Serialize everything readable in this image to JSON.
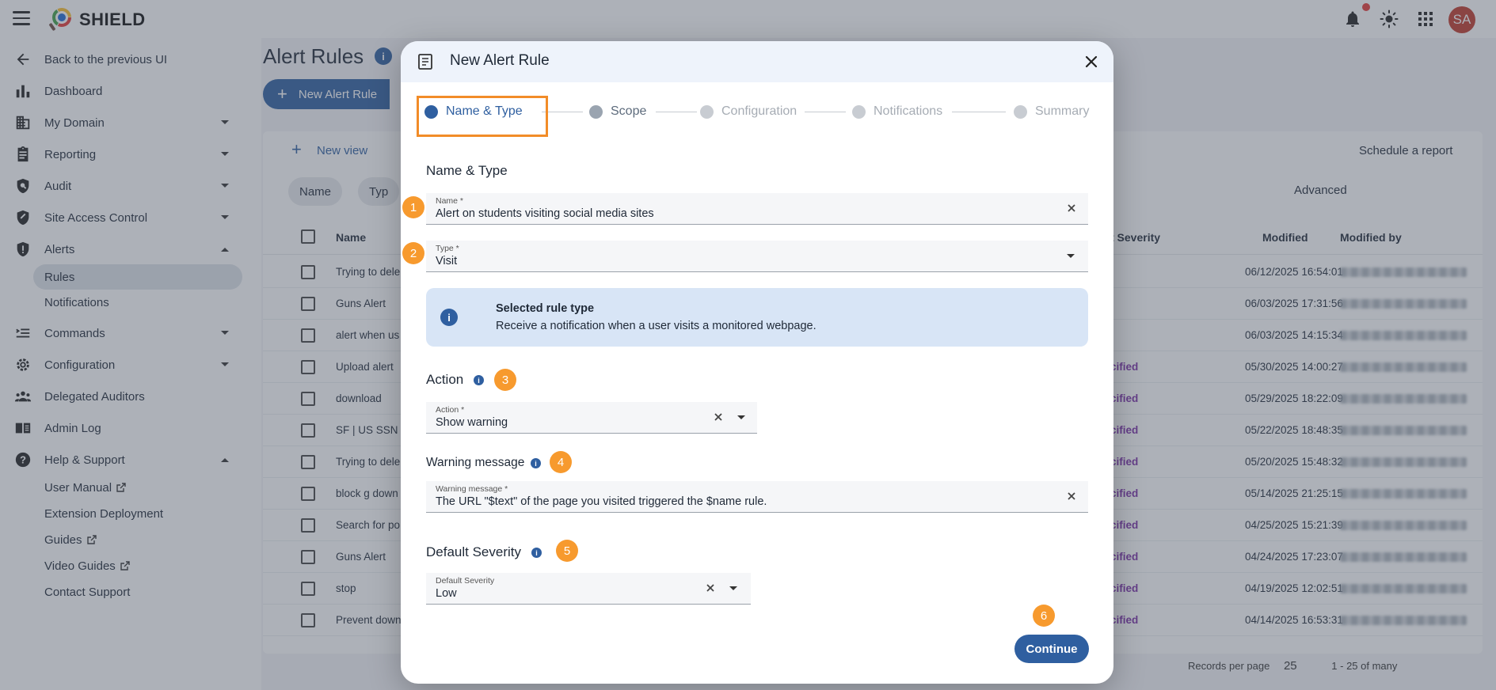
{
  "app": {
    "brand": "SHIELD",
    "avatar_initials": "SA"
  },
  "sidebar": {
    "items": [
      {
        "label": "Back to the previous UI"
      },
      {
        "label": "Dashboard"
      },
      {
        "label": "My Domain"
      },
      {
        "label": "Reporting"
      },
      {
        "label": "Audit"
      },
      {
        "label": "Site Access Control"
      },
      {
        "label": "Alerts"
      },
      {
        "label": "Commands"
      },
      {
        "label": "Configuration"
      },
      {
        "label": "Delegated Auditors"
      },
      {
        "label": "Admin Log"
      },
      {
        "label": "Help & Support"
      }
    ],
    "alerts_sub": [
      {
        "label": "Rules"
      },
      {
        "label": "Notifications"
      }
    ],
    "help_sub": [
      {
        "label": "User Manual"
      },
      {
        "label": "Extension Deployment"
      },
      {
        "label": "Guides"
      },
      {
        "label": "Video Guides"
      },
      {
        "label": "Contact Support"
      }
    ]
  },
  "page": {
    "title": "Alert Rules",
    "new_rule_button": "New Alert Rule",
    "new_view": "New view",
    "schedule_report": "Schedule a report",
    "advanced": "Advanced",
    "filter_chips": [
      "Name",
      "Typ"
    ],
    "columns": {
      "name": "Name",
      "severity": "t Severity",
      "modified": "Modified",
      "modified_by": "Modified by"
    },
    "rows": [
      {
        "name": "Trying to dele",
        "severity": "",
        "modified": "06/12/2025 16:54:01"
      },
      {
        "name": "Guns Alert",
        "severity": "",
        "modified": "06/03/2025 17:31:56"
      },
      {
        "name": "alert when us",
        "severity": "",
        "modified": "06/03/2025 14:15:34"
      },
      {
        "name": "Upload alert",
        "severity": "cified",
        "modified": "05/30/2025 14:00:27"
      },
      {
        "name": "download",
        "severity": "cified",
        "modified": "05/29/2025 18:22:09"
      },
      {
        "name": "SF | US SSN I",
        "severity": "cified",
        "modified": "05/22/2025 18:48:35"
      },
      {
        "name": "Trying to dele",
        "severity": "cified",
        "modified": "05/20/2025 15:48:32"
      },
      {
        "name": "block g down",
        "severity": "cified",
        "modified": "05/14/2025 21:25:15"
      },
      {
        "name": "Search for po",
        "severity": "cified",
        "modified": "04/25/2025 15:21:39"
      },
      {
        "name": "Guns Alert",
        "severity": "cified",
        "modified": "04/24/2025 17:23:07"
      },
      {
        "name": "stop",
        "severity": "cified",
        "modified": "04/19/2025 12:02:51"
      },
      {
        "name": "Prevent down",
        "severity": "cified",
        "modified": "04/14/2025 16:53:31"
      }
    ],
    "records_per_page_label": "Records per page",
    "records_per_page_value": "25",
    "range": "1 - 25 of many"
  },
  "modal": {
    "title": "New Alert Rule",
    "steps": [
      "Name & Type",
      "Scope",
      "Configuration",
      "Notifications",
      "Summary"
    ],
    "section_title": "Name & Type",
    "name_field": {
      "label": "Name *",
      "value": "Alert on students visiting social media sites"
    },
    "type_field": {
      "label": "Type *",
      "value": "Visit"
    },
    "info_box": {
      "title": "Selected rule type",
      "text": "Receive a notification when a user visits a monitored webpage."
    },
    "action_section": "Action",
    "action_field": {
      "label": "Action *",
      "value": "Show warning"
    },
    "warning_section": "Warning message",
    "warning_field": {
      "label": "Warning message *",
      "value": "The URL \"$text\" of the page you visited triggered the $name rule."
    },
    "severity_section": "Default Severity",
    "severity_field": {
      "label": "Default Severity",
      "value": "Low"
    },
    "continue_button": "Continue",
    "badges": [
      "1",
      "2",
      "3",
      "4",
      "5",
      "6"
    ]
  },
  "colors": {
    "primary": "#2f5fa0",
    "highlight": "#f28c28",
    "badge": "#f79a2e"
  }
}
